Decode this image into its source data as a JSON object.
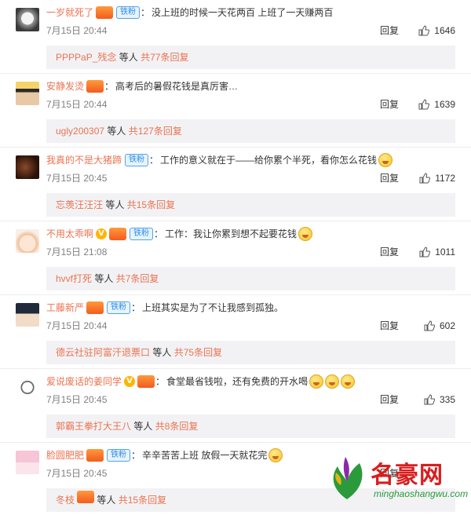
{
  "colors": {
    "username": "#eb7350",
    "fan_badge": "#2e8de5",
    "sub_bg": "#f2f2f5"
  },
  "labels": {
    "reply": "回复",
    "fan_badge": "铁粉",
    "v_badge": "V",
    "etc": "等人",
    "sub_prefix": "共",
    "sub_suffix": "条回复"
  },
  "comments": [
    {
      "username": "一岁就死了",
      "badges": [
        "level",
        "fan"
      ],
      "text": "没上班的时候一天花两百 上班了一天赚两百",
      "time": "7月15日 20:44",
      "likes": "1646",
      "sub_user": "PPPPaP_残念",
      "sub_count": "77",
      "avatar": "avatar-sketch"
    },
    {
      "username": "安静发烫",
      "badges": [
        "level"
      ],
      "text": "高考后的暑假花钱是真厉害…",
      "time": "7月15日 20:44",
      "likes": "1639",
      "sub_user": "ugly200307",
      "sub_count": "127",
      "avatar": "avatar-crown"
    },
    {
      "username": "我真的不是大猪蹄",
      "badges": [
        "fan"
      ],
      "text": "工作的意义就在于——给你累个半死，看你怎么花钱",
      "time": "7月15日 20:45",
      "likes": "1172",
      "sub_user": "忘羡汪汪汪",
      "sub_count": "15",
      "avatar": "avatar-dark"
    },
    {
      "username": "不用太乖啊",
      "badges": [
        "v",
        "level",
        "fan"
      ],
      "text": "工作：我让你累到想不起要花钱",
      "time": "7月15日 21:08",
      "likes": "1011",
      "sub_user": "hvvf打死",
      "sub_count": "7",
      "avatar": "avatar-cartoon"
    },
    {
      "username": "工藤新严",
      "badges": [
        "level",
        "fan"
      ],
      "text": "上班其实是为了不让我感到孤独。",
      "time": "7月15日 20:44",
      "likes": "602",
      "sub_user": "德云社驻阿富汗退票口",
      "sub_count": "75",
      "avatar": "avatar-anime"
    },
    {
      "username": "爱说废话的姜同学",
      "badges": [
        "v",
        "level"
      ],
      "text": "食堂最省钱啦，还有免费的开水喝",
      "time": "7月15日 20:45",
      "likes": "335",
      "sub_user": "郭霸王拳打大王八",
      "sub_count": "8",
      "avatar": "avatar-logo"
    },
    {
      "username": "脸圆肥肥",
      "badges": [
        "level",
        "fan"
      ],
      "text": "辛辛苦苦上班 放假一天就花完",
      "time": "7月15日 20:45",
      "likes": "",
      "sub_user": "冬枝",
      "sub_count": "15",
      "avatar": "avatar-pink"
    }
  ],
  "watermark": {
    "name": "名豪网",
    "url": "minghaoshangwu.com"
  }
}
